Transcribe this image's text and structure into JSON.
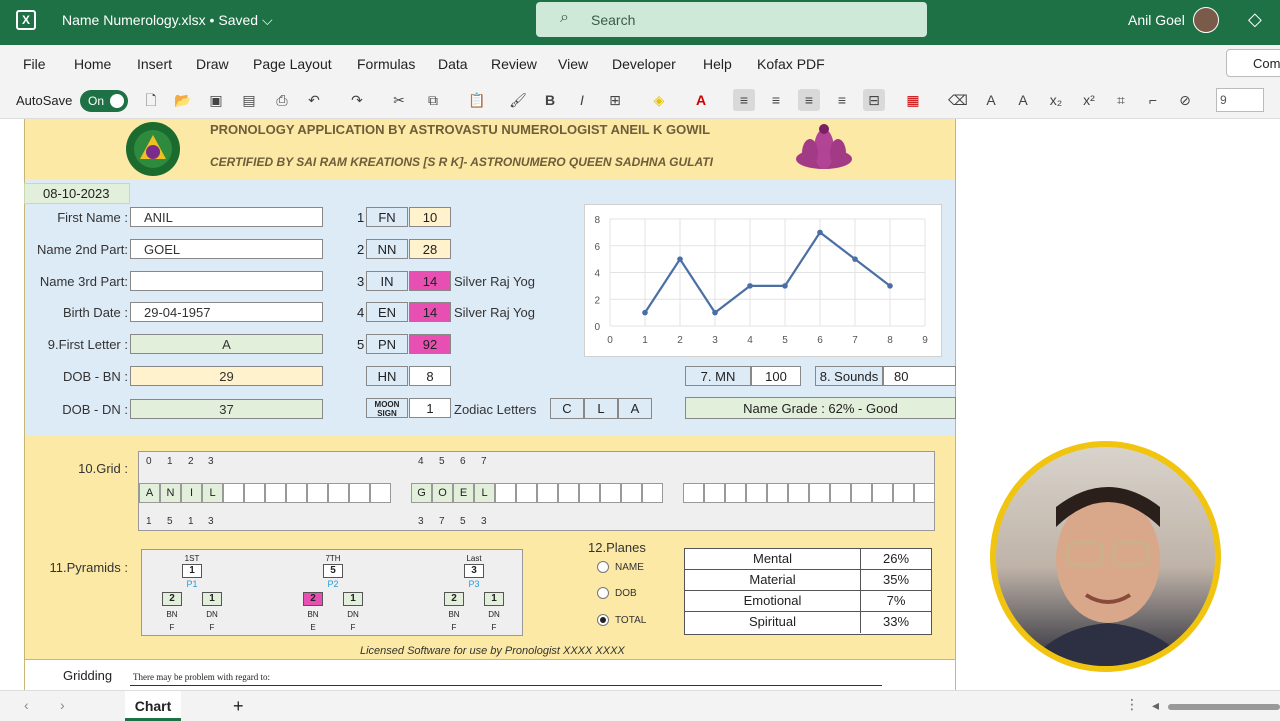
{
  "titlebar": {
    "doc_title": "Name Numerology.xlsx • Saved ⌵",
    "search_placeholder": "Search",
    "user_name": "Anil Goel"
  },
  "menu": [
    "File",
    "Home",
    "Insert",
    "Draw",
    "Page Layout",
    "Formulas",
    "Data",
    "Review",
    "View",
    "Developer",
    "Help",
    "Kofax PDF"
  ],
  "menu_comments": "Com",
  "ribbon": {
    "autosave_label": "AutoSave",
    "toggle_label": "On",
    "font_size": "9"
  },
  "header": {
    "line1": "PRONOLOGY APPLICATION BY ASTROVASTU NUMEROLOGIST ANEIL K GOWIL",
    "line2": "CERTIFIED BY SAI RAM KREATIONS [S R K]- ASTRONUMERO QUEEN SADHNA GULATI"
  },
  "form": {
    "date": "08-10-2023",
    "first_name_label": "First Name :",
    "first_name": "ANIL",
    "name2_label": "Name 2nd Part:",
    "name2": "GOEL",
    "name3_label": "Name 3rd Part:",
    "name3": "",
    "birth_label": "Birth Date :",
    "birth": "29-04-1957",
    "first_letter_label": "9.First Letter :",
    "first_letter": "A",
    "dob_bn_label": "DOB - BN :",
    "dob_bn": "29",
    "dob_dn_label": "DOB - DN :",
    "dob_dn": "37"
  },
  "codes": [
    {
      "idx": "1",
      "code": "FN",
      "value": "10",
      "note": ""
    },
    {
      "idx": "2",
      "code": "NN",
      "value": "28",
      "note": ""
    },
    {
      "idx": "3",
      "code": "IN",
      "value": "14",
      "note": "Silver Raj Yog"
    },
    {
      "idx": "4",
      "code": "EN",
      "value": "14",
      "note": "Silver Raj Yog"
    },
    {
      "idx": "5",
      "code": "PN",
      "value": "92",
      "note": ""
    },
    {
      "idx": "",
      "code": "HN",
      "value": "8",
      "note": ""
    }
  ],
  "moon": {
    "label": "MOON SIGN",
    "value": "1",
    "zodiac_label": "Zodiac Letters",
    "letters": [
      "C",
      "L",
      "A"
    ]
  },
  "mn": {
    "label": "7. MN",
    "value": "100",
    "sounds_label": "8. Sounds",
    "sounds_value": "80"
  },
  "grade": "Name Grade : 62% - Good",
  "chart_data": {
    "type": "line",
    "x": [
      1,
      2,
      3,
      4,
      5,
      6,
      7,
      8
    ],
    "values": [
      1,
      5,
      1,
      3,
      3,
      7,
      5,
      3
    ],
    "xlim": [
      0,
      9
    ],
    "ylim": [
      0,
      8
    ],
    "xticks": [
      "0",
      "1",
      "2",
      "3",
      "4",
      "5",
      "6",
      "7",
      "8",
      "9"
    ],
    "yticks": [
      "0",
      "2",
      "4",
      "6",
      "8"
    ],
    "color": "#4a6fa5"
  },
  "grid": {
    "label": "10.Grid :",
    "top_left": [
      "0",
      "1",
      "2",
      "3"
    ],
    "top_mid": [
      "4",
      "5",
      "6",
      "7"
    ],
    "bottom_left": [
      "1",
      "5",
      "1",
      "3"
    ],
    "bottom_mid": [
      "3",
      "7",
      "5",
      "3"
    ],
    "cells_left": [
      "A",
      "N",
      "I",
      "L"
    ],
    "cells_mid": [
      "G",
      "O",
      "E",
      "L"
    ]
  },
  "pyramids": {
    "label": "11.Pyramids :",
    "p1": {
      "title": "1ST",
      "top": "1",
      "name": "P1",
      "left": "2",
      "right": "1",
      "bl": "BN",
      "br": "DN",
      "fl": "F",
      "fr": "F"
    },
    "p2": {
      "title": "7TH",
      "top": "5",
      "name": "P2",
      "left": "2",
      "right": "1",
      "bl": "BN",
      "br": "DN",
      "fl": "E",
      "fr": "F"
    },
    "p3": {
      "title": "Last",
      "top": "3",
      "name": "P3",
      "left": "2",
      "right": "1",
      "bl": "BN",
      "br": "DN",
      "fl": "F",
      "fr": "F"
    }
  },
  "planes": {
    "label": "12.Planes",
    "options": [
      "NAME",
      "DOB",
      "TOTAL"
    ],
    "rows": [
      {
        "name": "Mental",
        "value": "26%"
      },
      {
        "name": "Material",
        "value": "35%"
      },
      {
        "name": "Emotional",
        "value": "7%"
      },
      {
        "name": "Spiritual",
        "value": "33%"
      }
    ]
  },
  "licensed": "Licensed Software for use by Pronologist XXXX XXXX",
  "gridding": {
    "label": "Gridding",
    "text": "There may be problem with regard to:"
  },
  "tabs": {
    "active": "Chart",
    "add": "+"
  }
}
